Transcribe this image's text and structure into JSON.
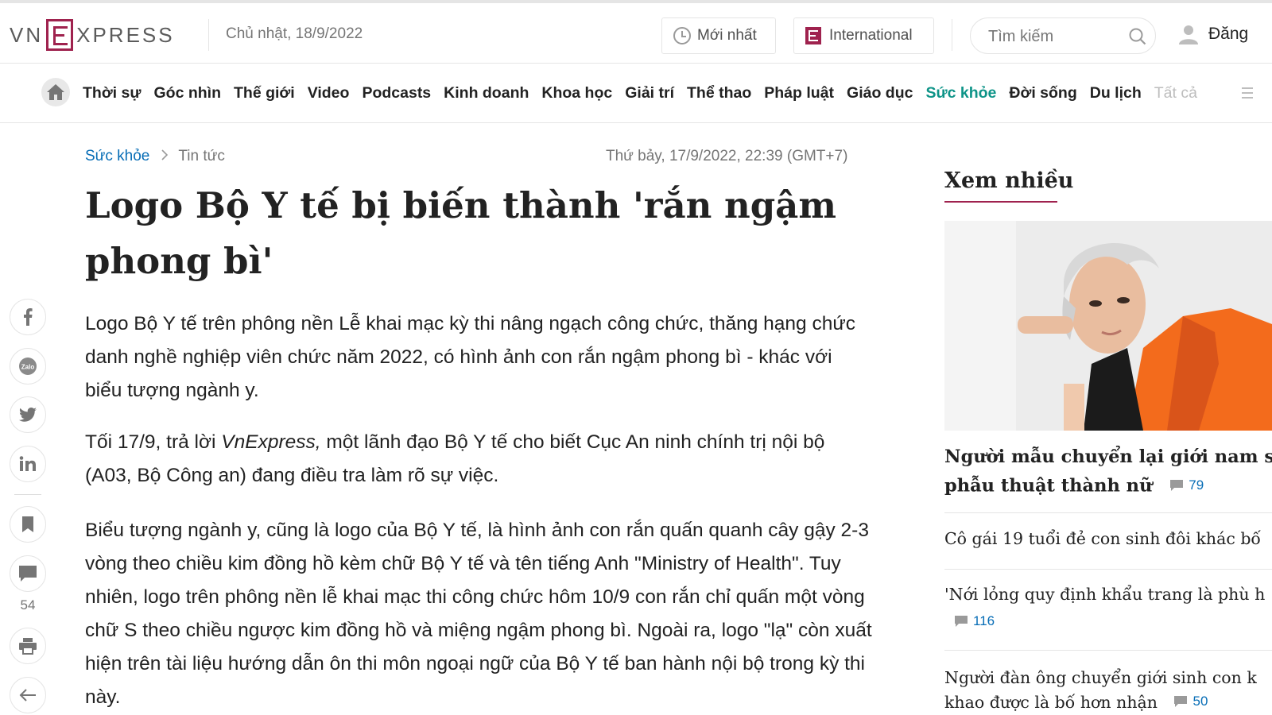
{
  "header": {
    "logo_vn": "VN",
    "logo_express": "XPRESS",
    "date": "Chủ nhật, 18/9/2022",
    "latest_label": "Mới nhất",
    "international_label": "International",
    "search_placeholder": "Tìm kiếm",
    "login_label": "Đăng"
  },
  "nav": {
    "items": [
      "Thời sự",
      "Góc nhìn",
      "Thế giới",
      "Video",
      "Podcasts",
      "Kinh doanh",
      "Khoa học",
      "Giải trí",
      "Thể thao",
      "Pháp luật",
      "Giáo dục",
      "Sức khỏe",
      "Đời sống",
      "Du lịch"
    ],
    "more_label": "Tất cả"
  },
  "article": {
    "breadcrumb_category": "Sức khỏe",
    "breadcrumb_sub": "Tin tức",
    "published": "Thứ bảy, 17/9/2022, 22:39 (GMT+7)",
    "title": "Logo Bộ Y tế bị biến thành 'rắn ngậm phong bì'",
    "lead": "Logo Bộ Y tế trên phông nền Lễ khai mạc kỳ thi nâng ngạch công chức, thăng hạng chức danh nghề nghiệp viên chức năm 2022, có hình ảnh con rắn ngậm phong bì - khác với biểu tượng ngành y.",
    "p1_before": "Tối 17/9, trả lời ",
    "p1_italic": "VnExpress,",
    "p1_after": " một lãnh đạo Bộ Y tế cho biết Cục An ninh chính trị nội bộ (A03, Bộ Công an) đang điều tra làm rõ sự việc.",
    "p2": "Biểu tượng ngành y, cũng là logo của Bộ Y tế, là hình ảnh con rắn quấn quanh cây gậy 2-3 vòng theo chiều kim đồng hồ kèm chữ Bộ Y tế và tên tiếng Anh \"Ministry of Health\". Tuy nhiên, logo trên phông nền lễ khai mạc thi công chức hôm 10/9 con rắn chỉ quấn một vòng chữ S theo chiều ngược kim đồng hồ và miệng ngậm phong bì. Ngoài ra, logo \"lạ\" còn xuất hiện trên tài liệu hướng dẫn ôn thi môn ngoại ngữ của Bộ Y tế ban hành nội bộ trong kỳ thi này.",
    "comment_count": "54"
  },
  "sidebar": {
    "heading": "Xem nhiều",
    "items": [
      {
        "title_line1": "Người mẫu chuyển lại giới nam sau",
        "title_line2": "phẫu thuật thành nữ",
        "comments": "79"
      },
      {
        "title": "Cô gái 19 tuổi đẻ con sinh đôi khác bố"
      },
      {
        "title": "'Nới lỏng quy định khẩu trang là phù h",
        "comments": "116"
      },
      {
        "title_line1": "Người đàn ông chuyển giới sinh con k",
        "title_line2": "khao được là bố hơn nhận",
        "comments": "50"
      }
    ]
  },
  "colors": {
    "brand": "#9f224e",
    "link": "#076db6",
    "active_nav": "#0e9488"
  }
}
